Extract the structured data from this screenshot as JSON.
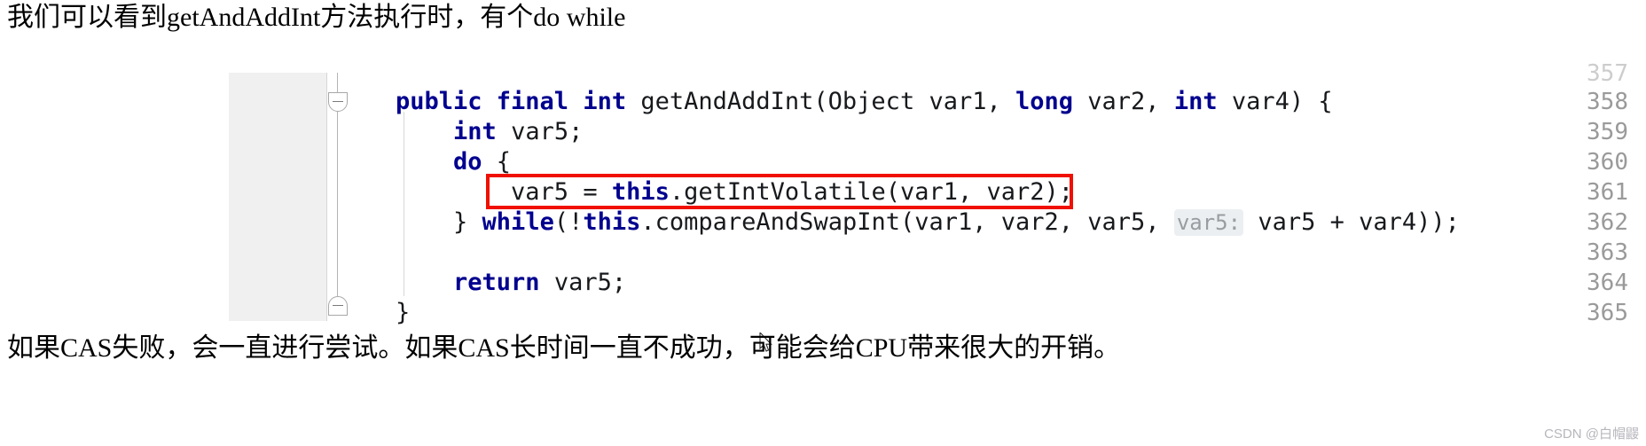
{
  "article": {
    "intro_text": "我们可以看到getAndAddInt方法执行时，有个do while",
    "outro_text": "如果CAS失败，会一直进行尝试。如果CAS长时间一直不成功，可能会给CPU带来很大的开销。"
  },
  "watermark": {
    "text": "CSDN @白帽鼹"
  },
  "editor": {
    "gutter_color": "#f0f0f0",
    "keyword_color": "#00008f",
    "text_color": "#17191c",
    "hint_color": "#999da1",
    "annotation_color": "#f01000",
    "line_numbers": [
      "357",
      "358",
      "359",
      "360",
      "361",
      "362",
      "363",
      "364",
      "365"
    ],
    "lines": [
      {
        "number": "358",
        "segments": [
          {
            "text": "public final int ",
            "style": "kw"
          },
          {
            "text": "getAndAddInt(Object var1, ",
            "style": "plain"
          },
          {
            "text": "long ",
            "style": "kw"
          },
          {
            "text": "var2, ",
            "style": "plain"
          },
          {
            "text": "int ",
            "style": "kw"
          },
          {
            "text": "var4) {",
            "style": "plain"
          }
        ],
        "plain_text": "public final int getAndAddInt(Object var1, long var2, int var4) {"
      },
      {
        "number": "359",
        "segments": [
          {
            "text": "    ",
            "style": "plain"
          },
          {
            "text": "int ",
            "style": "kw"
          },
          {
            "text": "var5;",
            "style": "plain"
          }
        ],
        "plain_text": "    int var5;"
      },
      {
        "number": "360",
        "segments": [
          {
            "text": "    ",
            "style": "plain"
          },
          {
            "text": "do",
            "style": "kw"
          },
          {
            "text": " {",
            "style": "plain"
          }
        ],
        "plain_text": "    do {"
      },
      {
        "number": "361",
        "segments": [
          {
            "text": "        var5 = ",
            "style": "plain"
          },
          {
            "text": "this",
            "style": "kw"
          },
          {
            "text": ".getIntVolatile(var1, var2);",
            "style": "plain"
          }
        ],
        "plain_text": "        var5 = this.getIntVolatile(var1, var2);"
      },
      {
        "number": "362",
        "segments": [
          {
            "text": "    } ",
            "style": "plain"
          },
          {
            "text": "while",
            "style": "kw"
          },
          {
            "text": "(!",
            "style": "plain"
          },
          {
            "text": "this",
            "style": "kw"
          },
          {
            "text": ".compareAndSwapInt(var1, var2, var5, ",
            "style": "plain"
          },
          {
            "text": "var5:",
            "style": "hint"
          },
          {
            "text": " var5 + var4));",
            "style": "plain"
          }
        ],
        "plain_text": "    } while(!this.compareAndSwapInt(var1, var2, var5, var5: var5 + var4));"
      },
      {
        "number": "363",
        "segments": [],
        "plain_text": ""
      },
      {
        "number": "364",
        "segments": [
          {
            "text": "    ",
            "style": "plain"
          },
          {
            "text": "return",
            "style": "kw"
          },
          {
            "text": " var5;",
            "style": "plain"
          }
        ],
        "plain_text": "    return var5;"
      },
      {
        "number": "365",
        "segments": [
          {
            "text": "}",
            "style": "plain"
          }
        ],
        "plain_text": "}"
      }
    ],
    "inline_hint": "var5:",
    "fold_markers": [
      "fold-collapse-method",
      "fold-collapse-end"
    ]
  }
}
